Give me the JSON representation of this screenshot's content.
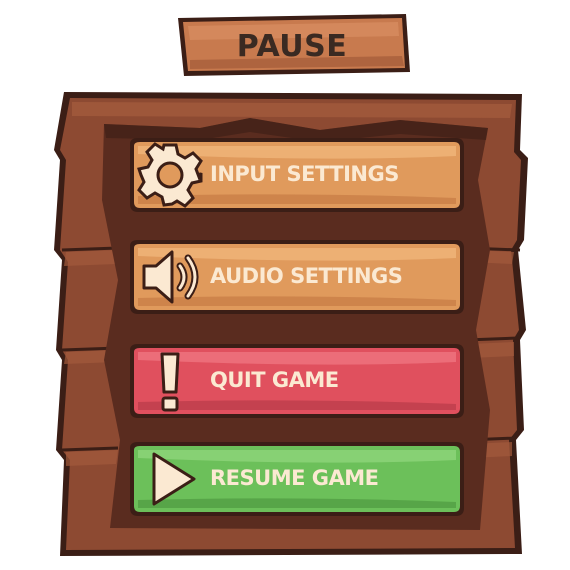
{
  "title": "PAUSE",
  "menu": {
    "input_settings": "INPUT SETTINGS",
    "audio_settings": "AUDIO SETTINGS",
    "quit_game": "QUIT GAME",
    "resume_game": "RESUME GAME"
  },
  "icons": {
    "input_settings": "gear-icon",
    "audio_settings": "speaker-icon",
    "quit_game": "exclamation-icon",
    "resume_game": "play-icon"
  },
  "colors": {
    "wood_dark": "#7a3f2a",
    "wood_mid": "#8d4a32",
    "wood_inner": "#5a2c1f",
    "outline": "#3b1e16",
    "title_plank": "#c87a4e",
    "btn_orange": "#e09a5c",
    "btn_red": "#e0505e",
    "btn_green": "#6cc05a",
    "label": "#fbe9d2"
  }
}
